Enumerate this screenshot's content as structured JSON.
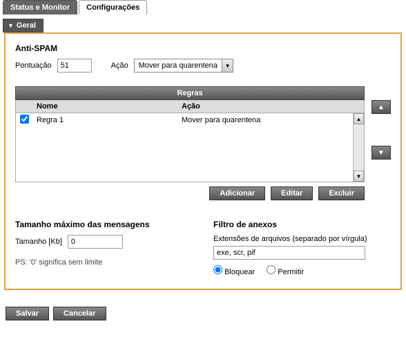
{
  "tabs": {
    "inactive": "Status e Monitor",
    "active": "Configurações"
  },
  "section": "Geral",
  "antispam": {
    "title": "Anti-SPAM",
    "score_label": "Pontuação",
    "score_value": "51",
    "action_label": "Ação",
    "action_selected": "Mover para quarentena"
  },
  "rules": {
    "title": "Regras",
    "col_name": "Nome",
    "col_action": "Ação",
    "row1_name": "Regra 1",
    "row1_action": "Mover para quarentena",
    "btn_add": "Adicionar",
    "btn_edit": "Editar",
    "btn_del": "Excluir"
  },
  "size": {
    "title": "Tamanho máximo das mensagens",
    "label": "Tamanho [Kb]",
    "value": "0",
    "hint": "PS: '0' significa sem limite"
  },
  "filter": {
    "title": "Filtro de anexos",
    "ext_label": "Extensões de arquivos (separado por vírgula)",
    "ext_value": "exe, scr, pif",
    "opt_block": "Bloquear",
    "opt_allow": "Permitir"
  },
  "footer": {
    "save": "Salvar",
    "cancel": "Cancelar"
  }
}
